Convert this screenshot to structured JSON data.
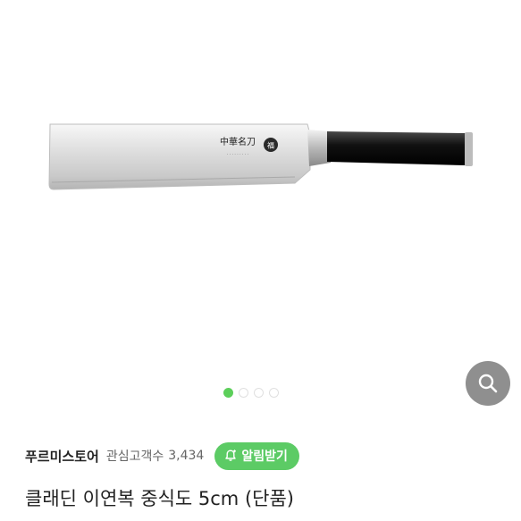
{
  "product_image": {
    "blade_text": "中華名刀",
    "blade_logo_char": "福",
    "carousel": {
      "count": 4,
      "active_index": 0
    },
    "zoom_icon": "magnifier-icon"
  },
  "store": {
    "name": "푸르미스토어",
    "interest_label": "관심고객수",
    "interest_count": "3,434",
    "notify_label": "알림받기",
    "notify_icon": "bell-plus-icon"
  },
  "product": {
    "title": "클래딘 이연복 중식도 5cm (단품)"
  },
  "colors": {
    "accent_green": "#5ccb65",
    "zoom_button_bg": "#8f8f8f"
  }
}
